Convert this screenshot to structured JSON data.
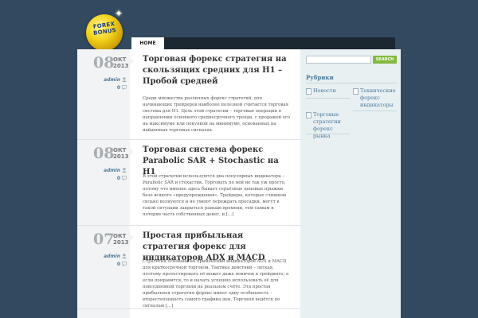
{
  "logo": {
    "text_line1": "FOREX",
    "text_line2": "BONUS"
  },
  "nav": {
    "home_label": "HOME"
  },
  "posts": [
    {
      "day": "08",
      "month": "ОКТ",
      "year": "2013",
      "author": "admin",
      "comments": "0",
      "title": "Торговая форекс стратегия на скользящих средних для H1 – Пробой средней",
      "excerpt": "Среди множества различных форекс стратегий, для начинающих трейдеров наиболее полезной считается торговая система для H1. Цель этой стратегии – торговые операции в направлении основного среднесрочного тренда, с продажей его на максимуме или покупкой на минимуме, основанных на найденных торговых сигналах."
    },
    {
      "day": "08",
      "month": "ОКТ",
      "year": "2013",
      "author": "admin",
      "comments": "0",
      "title": "Торговая система форекс Parabolic SAR + Stochastic на H1",
      "excerpt": "В этой стратегии используются два популярных индикатора – Parabolic SAR и стохастик. Торговать по ней не так уж просто, потому что именно здесь бывает серьёзные ценовые прыжки безо всякого «предупреждения». Трейдеры, которые слишком сильно волнуются и не умеют переждать просадки, могут в такой ситуации закрыться раньше времени, тем самым и потеряв часть собственных денег, и [...]"
    },
    {
      "day": "07",
      "month": "ОКТ",
      "year": "2013",
      "author": "admin",
      "comments": "0",
      "title": "Простая прибыльная стратегия форекс для индикаторов ADX и MACD",
      "excerpt": "Стратегия основана на применении индикаторов ADX и MACD для краткосрочной торговли. Тактика действий – лёгкая, поэтому протестировать её может даже новичок в трейдинге; а если понравится, то и начать успешно использовать её для повседневной торговли на реальном счёте. Эта простая прибыльная стратегия форекс имеет одну особенность – второстепенность самого графика цен. Торговля ведётся по сигналам [...]"
    }
  ],
  "sidebar": {
    "search_button": "SEARCH",
    "categories_heading": "Рубрики",
    "categories": [
      "Новости",
      "Технические форекс индикаторы",
      "Торговые стратегии форекс рынка"
    ]
  },
  "colors": {
    "background": "#33495f",
    "accent_blue": "#4d7a9a",
    "search_green": "#83b93d"
  }
}
